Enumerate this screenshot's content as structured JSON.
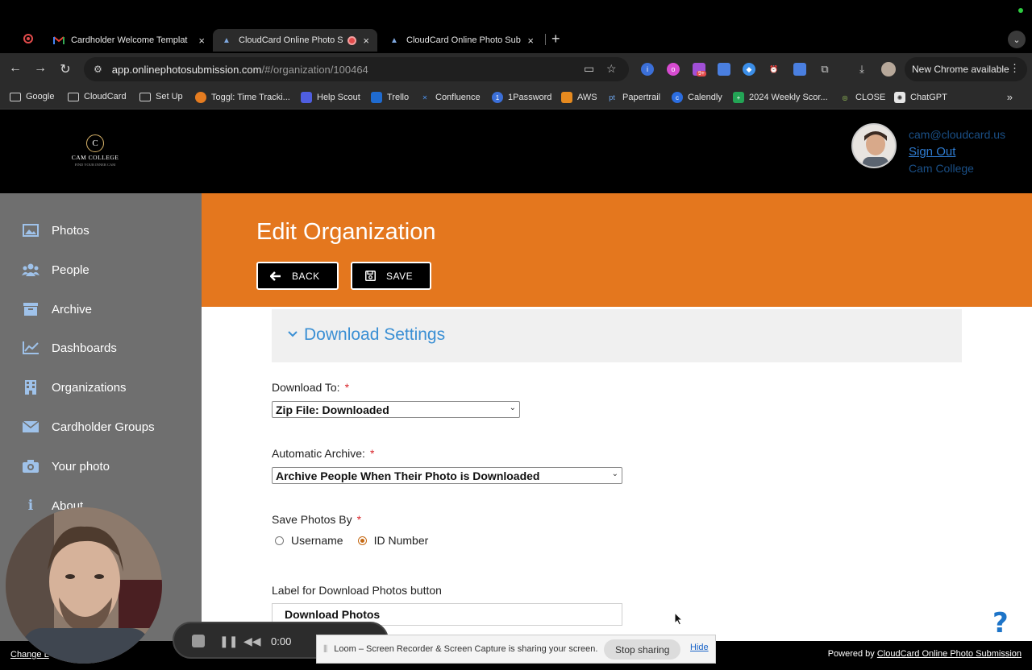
{
  "browser": {
    "tabs": [
      {
        "title": "Cardholder Welcome Templat",
        "favicon": "gmail-icon"
      },
      {
        "title": "CloudCard Online Photo S",
        "favicon": "cloudcard-icon",
        "active": true
      },
      {
        "title": "CloudCard Online Photo Subm",
        "favicon": "cloudcard-icon"
      }
    ],
    "url_host": "app.onlinephotosubmission.com",
    "url_path": "/#/organization/100464",
    "update_button": "New Chrome available",
    "extension_badge": "9+",
    "bookmarks": [
      "Google",
      "CloudCard",
      "Set Up",
      "Toggl: Time Tracki...",
      "Help Scout",
      "Trello",
      "Confluence",
      "1Password",
      "AWS",
      "Papertrail",
      "Calendly",
      "2024 Weekly Scor...",
      "CLOSE",
      "ChatGPT"
    ]
  },
  "header": {
    "logo": {
      "monogram": "C",
      "name": "CAM COLLEGE",
      "tagline": "FIND YOUR INNER CAM"
    },
    "user": {
      "email": "cam@cloudcard.us",
      "sign_out": "Sign Out",
      "org": "Cam College"
    }
  },
  "sidebar": {
    "items": [
      {
        "label": "Photos",
        "icon": "photos-icon"
      },
      {
        "label": "People",
        "icon": "people-icon"
      },
      {
        "label": "Archive",
        "icon": "archive-icon"
      },
      {
        "label": "Dashboards",
        "icon": "dashboards-icon"
      },
      {
        "label": "Organizations",
        "icon": "organizations-icon"
      },
      {
        "label": "Cardholder Groups",
        "icon": "envelope-icon"
      },
      {
        "label": "Your photo",
        "icon": "camera-icon"
      },
      {
        "label": "About",
        "icon": "info-icon"
      }
    ]
  },
  "main": {
    "title": "Edit Organization",
    "back_label": "BACK",
    "save_label": "SAVE",
    "section_title": "Download Settings",
    "download_to": {
      "label": "Download To:",
      "value": "Zip File: Downloaded"
    },
    "auto_archive": {
      "label": "Automatic Archive:",
      "value": "Archive People When Their Photo is Downloaded"
    },
    "save_photos_by": {
      "label": "Save Photos By",
      "options": [
        "Username",
        "ID Number"
      ],
      "selected": "ID Number"
    },
    "download_button_label": {
      "label": "Label for Download Photos button",
      "value": "Download Photos"
    }
  },
  "footer": {
    "left_link": "Change L",
    "powered_by": "Powered by",
    "powered_link": "CloudCard Online Photo Submission"
  },
  "loom": {
    "time": "0:00",
    "share_message": "Loom – Screen Recorder & Screen Capture is sharing your screen.",
    "stop_sharing": "Stop sharing",
    "hide": "Hide"
  },
  "colors": {
    "banner": "#e4771e",
    "accent_blue": "#3a8fd4",
    "sidebar": "#6f6f6f",
    "required": "#d9262c"
  }
}
